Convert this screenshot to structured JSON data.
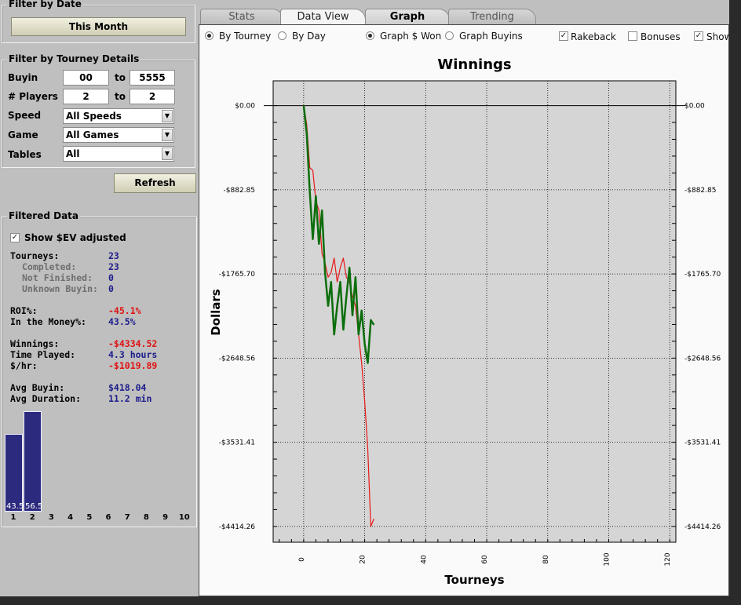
{
  "filter_by_date": {
    "legend": "Filter by Date",
    "button": "This Month"
  },
  "filter_by_tourney": {
    "legend": "Filter by Tourney Details",
    "buyin_label": "Buyin",
    "buyin_from": "00",
    "buyin_to": "5555",
    "to_label": "to",
    "players_label": "# Players",
    "players_from": "2",
    "players_to": "2",
    "speed_label": "Speed",
    "speed_value": "All Speeds",
    "game_label": "Game",
    "game_value": "All Games",
    "tables_label": "Tables",
    "tables_value": "All",
    "refresh": "Refresh"
  },
  "filtered_data": {
    "legend": "Filtered Data",
    "show_ev": "Show $EV adjusted",
    "stats": [
      {
        "label": "Tourneys:",
        "value": "23",
        "color": "blue",
        "dim": false
      },
      {
        "label": "Completed:",
        "value": "23",
        "color": "blue",
        "dim": true
      },
      {
        "label": "Not Finished:",
        "value": "0",
        "color": "blue",
        "dim": true
      },
      {
        "label": "Unknown Buyin:",
        "value": "0",
        "color": "blue",
        "dim": true
      },
      {
        "label": "ROI%:",
        "value": "-45.1%",
        "color": "red",
        "dim": false
      },
      {
        "label": "In the Money%:",
        "value": "43.5%",
        "color": "blue",
        "dim": false
      },
      {
        "label": "Winnings:",
        "value": "-$4334.52",
        "color": "red",
        "dim": false
      },
      {
        "label": "Time Played:",
        "value": "4.3 hours",
        "color": "blue",
        "dim": false
      },
      {
        "label": "$/hr:",
        "value": "-$1019.89",
        "color": "red",
        "dim": false
      },
      {
        "label": "Avg Buyin:",
        "value": "$418.04",
        "color": "blue",
        "dim": false
      },
      {
        "label": "Avg Duration:",
        "value": "11.2 min",
        "color": "blue",
        "dim": false
      }
    ],
    "histogram": {
      "ticks": [
        "1",
        "2",
        "3",
        "4",
        "5",
        "6",
        "7",
        "8",
        "9",
        "10"
      ],
      "bars": [
        {
          "label": "43.5",
          "value": 43.5
        },
        {
          "label": "56.5",
          "value": 56.5
        }
      ]
    }
  },
  "tabs": [
    {
      "label": "Stats",
      "active": false
    },
    {
      "label": "Data View",
      "active": true
    },
    {
      "label": "Graph",
      "active": false
    },
    {
      "label": "Trending",
      "active": false
    }
  ],
  "graph_options": {
    "by_tourney": "By Tourney",
    "by_day": "By Day",
    "graph_won": "Graph $ Won",
    "graph_buyins": "Graph Buyins",
    "rakeback": "Rakeback",
    "bonuses": "Bonuses",
    "show": "Show"
  },
  "chart_data": {
    "type": "line",
    "title": "Winnings",
    "xlabel": "Tourneys",
    "ylabel": "Dollars",
    "xlim": [
      -10,
      122
    ],
    "ylim": [
      -4580,
      260
    ],
    "x_ticks": [
      0,
      20,
      40,
      60,
      80,
      100,
      120
    ],
    "y_ticks": [
      0,
      -882.85,
      -1765.7,
      -2648.56,
      -3531.41,
      -4414.26
    ],
    "y_tick_labels": [
      "$0.00",
      "-$882.85",
      "-$1765.70",
      "-$2648.56",
      "-$3531.41",
      "-$4414.26"
    ],
    "grid": true,
    "series": [
      {
        "color": "#e81818",
        "x": [
          0,
          1,
          2,
          3,
          4,
          5,
          6,
          7,
          8,
          9,
          10,
          11,
          12,
          13,
          14,
          15,
          16,
          17,
          18,
          19,
          20,
          21,
          22,
          23
        ],
        "values": [
          0,
          -200,
          -650,
          -680,
          -1000,
          -1100,
          -1550,
          -1650,
          -1800,
          -1750,
          -1600,
          -1850,
          -1700,
          -1600,
          -1800,
          -1850,
          -2000,
          -2100,
          -2400,
          -2700,
          -3100,
          -3600,
          -4414,
          -4334
        ]
      },
      {
        "color": "#0c6e0c",
        "x": [
          0,
          1,
          2,
          3,
          4,
          5,
          6,
          7,
          8,
          9,
          10,
          11,
          12,
          13,
          14,
          15,
          16,
          17,
          18,
          19,
          20,
          21,
          22,
          23
        ],
        "values": [
          0,
          -300,
          -900,
          -1400,
          -950,
          -1450,
          -1100,
          -1750,
          -2100,
          -1850,
          -2400,
          -2100,
          -1850,
          -2350,
          -2000,
          -1700,
          -2200,
          -1800,
          -2400,
          -2150,
          -2500,
          -2700,
          -2250,
          -2300
        ]
      }
    ]
  }
}
